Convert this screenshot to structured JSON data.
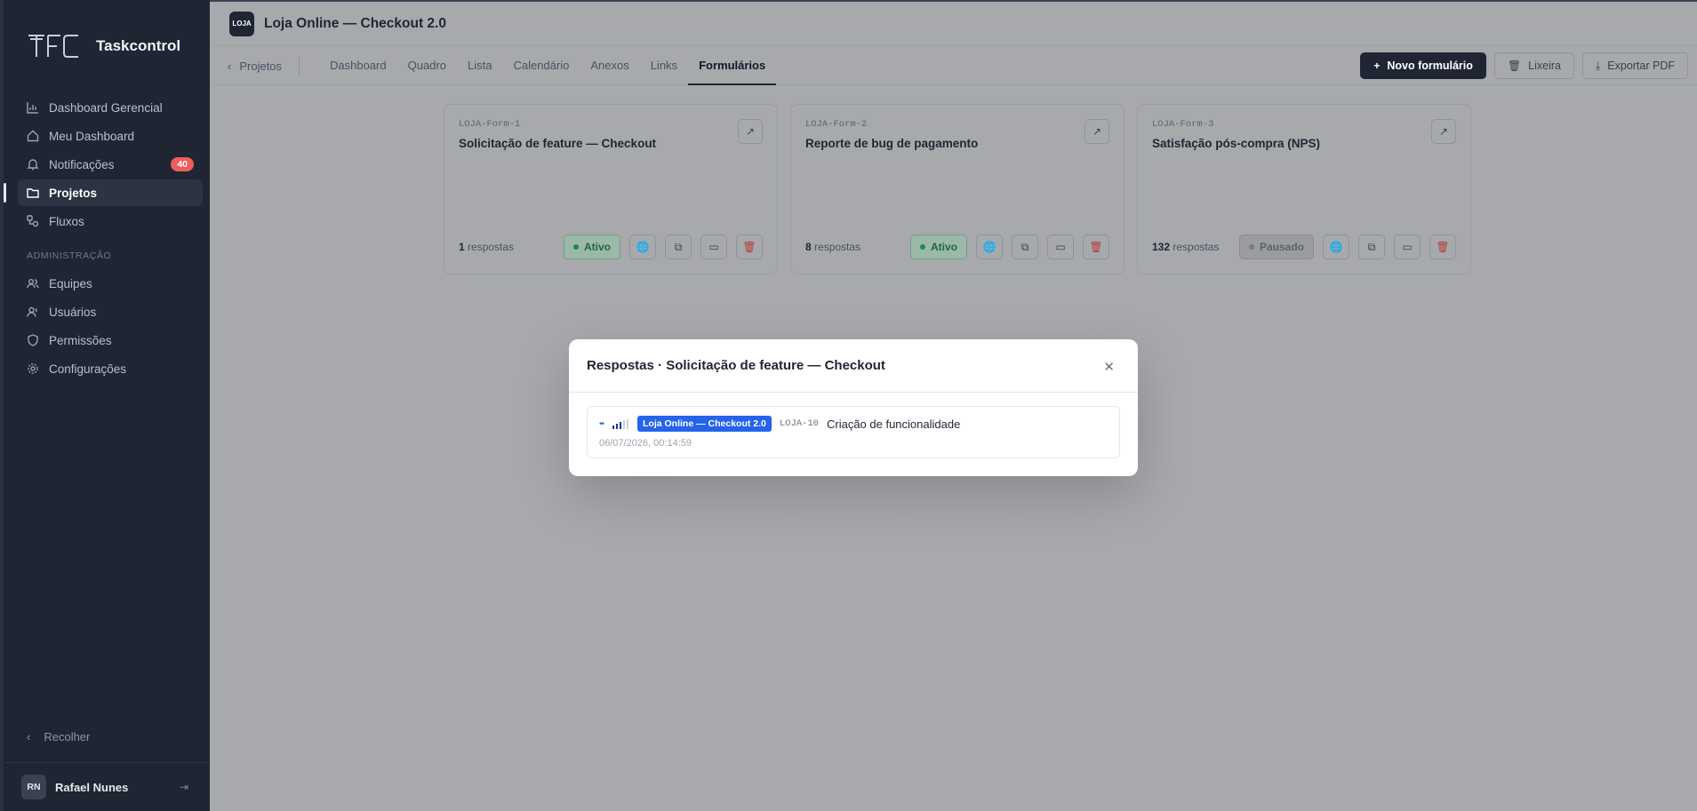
{
  "sidebar": {
    "brand": "Taskcontrol",
    "items": [
      {
        "label": "Dashboard Gerencial",
        "icon": "bar-chart-icon"
      },
      {
        "label": "Meu Dashboard",
        "icon": "home-icon"
      },
      {
        "label": "Notificações",
        "icon": "bell-icon",
        "badge": "40"
      },
      {
        "label": "Projetos",
        "icon": "folder-icon",
        "active": true
      },
      {
        "label": "Fluxos",
        "icon": "workflow-icon"
      }
    ],
    "admin_label": "ADMINISTRAÇÃO",
    "admin_items": [
      {
        "label": "Equipes",
        "icon": "users-icon"
      },
      {
        "label": "Usuários",
        "icon": "user-icon"
      },
      {
        "label": "Permissões",
        "icon": "shield-icon"
      },
      {
        "label": "Configurações",
        "icon": "gear-icon"
      }
    ],
    "collapse_label": "Recolher",
    "user": {
      "initials": "RN",
      "name": "Rafael Nunes"
    }
  },
  "header": {
    "project_logo": "LOJA",
    "project_title": "Loja Online — Checkout 2.0",
    "back_label": "Projetos",
    "tabs": [
      "Dashboard",
      "Quadro",
      "Lista",
      "Calendário",
      "Anexos",
      "Links",
      "Formulários"
    ],
    "active_tab": "Formulários",
    "actions": {
      "new_form": "Novo formulário",
      "trash": "Lixeira",
      "export": "Exportar PDF"
    }
  },
  "forms": [
    {
      "code": "LOJA-Form-1",
      "title": "Solicitação de feature — Checkout",
      "count": "1",
      "count_label": "respostas",
      "status": "Ativo"
    },
    {
      "code": "LOJA-Form-2",
      "title": "Reporte de bug de pagamento",
      "count": "8",
      "count_label": "respostas",
      "status": "Ativo"
    },
    {
      "code": "LOJA-Form-3",
      "title": "Satisfação pós-compra (NPS)",
      "count": "132",
      "count_label": "respostas",
      "status": "Pausado"
    }
  ],
  "modal": {
    "title": "Respostas · Solicitação de feature — Checkout",
    "response": {
      "priority": "••",
      "project_tag": "Loja Online — Checkout 2.0",
      "task_code": "LOJA-10",
      "task_title": "Criação de funcionalidade",
      "date": "06/07/2026, 00:14:59"
    }
  },
  "colors": {
    "sidebar_bg": "#1f2533",
    "accent": "#2563eb",
    "badge": "#ef5d5d",
    "active_status": "#1f8a4c",
    "danger": "#b73a3a"
  }
}
